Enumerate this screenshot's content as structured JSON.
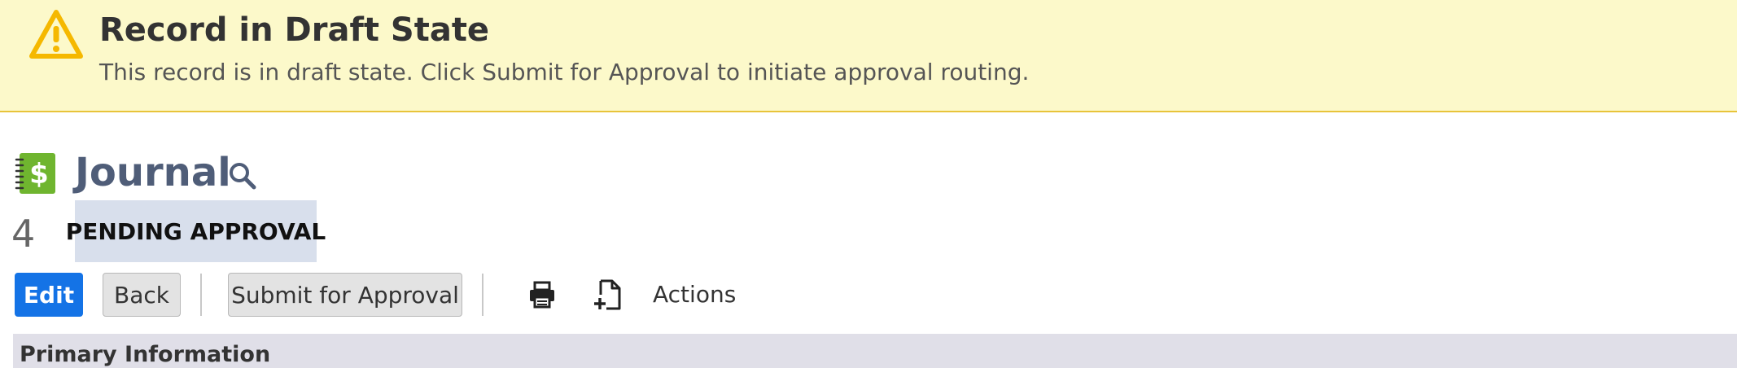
{
  "banner": {
    "title": "Record in Draft State",
    "message": "This record is in draft state. Click Submit for Approval to initiate approval routing.",
    "icon": "warning-icon",
    "background_color": "#fcf9ca",
    "accent_color": "#f5b800"
  },
  "record": {
    "icon": "journal-dollar-icon",
    "title": "Journal",
    "search_icon": "search-icon",
    "number": "4",
    "status": "PENDING APPROVAL"
  },
  "toolbar": {
    "edit_label": "Edit",
    "back_label": "Back",
    "submit_label": "Submit for Approval",
    "print_icon": "print-icon",
    "new_document_icon": "new-document-icon",
    "actions_label": "Actions",
    "primary_color": "#1473e6"
  },
  "section": {
    "title": "Primary Information"
  }
}
